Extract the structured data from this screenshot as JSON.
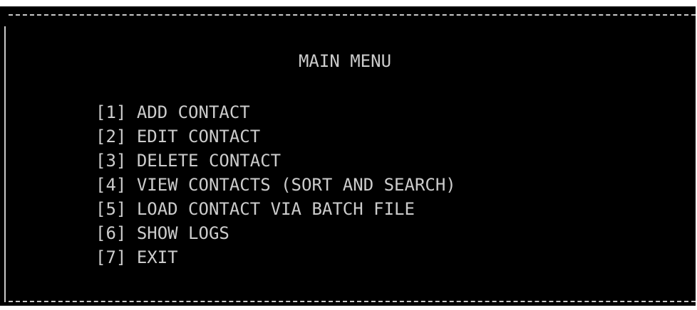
{
  "menu": {
    "title": "MAIN MENU",
    "items": [
      {
        "key": "[1]",
        "label": "ADD CONTACT"
      },
      {
        "key": "[2]",
        "label": "EDIT CONTACT"
      },
      {
        "key": "[3]",
        "label": "DELETE CONTACT"
      },
      {
        "key": "[4]",
        "label": "VIEW CONTACTS (SORT AND SEARCH)"
      },
      {
        "key": "[5]",
        "label": "LOAD CONTACT VIA BATCH FILE"
      },
      {
        "key": "[6]",
        "label": "SHOW LOGS"
      },
      {
        "key": "[7]",
        "label": "EXIT"
      }
    ]
  },
  "colors": {
    "background": "#000000",
    "text": "#cccccc",
    "border": "#c9c9c9"
  }
}
